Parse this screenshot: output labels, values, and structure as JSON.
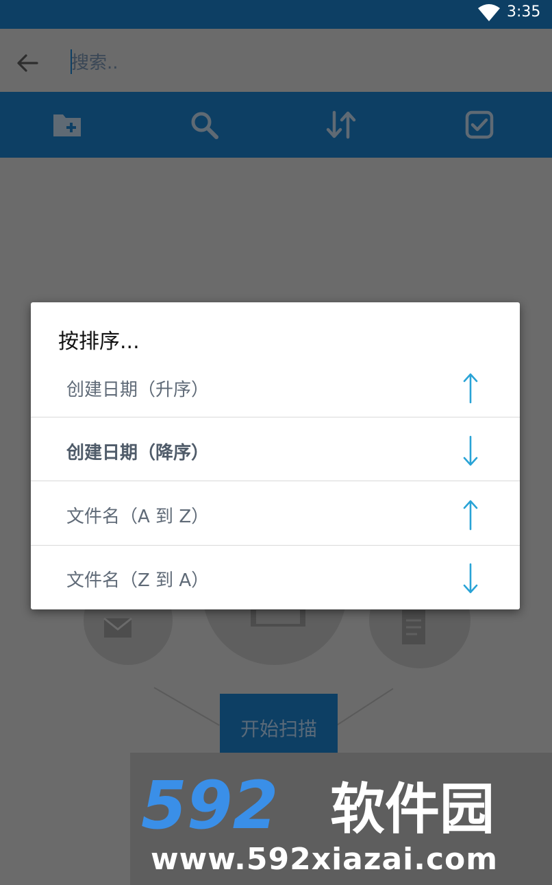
{
  "status_bar": {
    "time": "3:35"
  },
  "search": {
    "placeholder": "搜索.."
  },
  "toolbar": {
    "icons": [
      "add-folder-icon",
      "search-icon",
      "sort-icon",
      "select-all-icon"
    ]
  },
  "dialog": {
    "title": "按排序...",
    "options": [
      {
        "label": "创建日期（升序）",
        "direction": "up",
        "selected": false
      },
      {
        "label": "创建日期（降序）",
        "direction": "down",
        "selected": true
      },
      {
        "label": "文件名（A 到 Z）",
        "direction": "up",
        "selected": false
      },
      {
        "label": "文件名（Z 到 A）",
        "direction": "down",
        "selected": false
      }
    ]
  },
  "background": {
    "scan_button_label": "开始扫描"
  },
  "watermark": {
    "logo": "592软件园",
    "url": "www.592xiazai.com"
  },
  "colors": {
    "primary": "#0d3f64",
    "scrim": "#6b6b6b",
    "arrow_accent": "#29a3d6",
    "dialog_bg": "#ffffff",
    "watermark_blue": "#3a8fe8"
  }
}
